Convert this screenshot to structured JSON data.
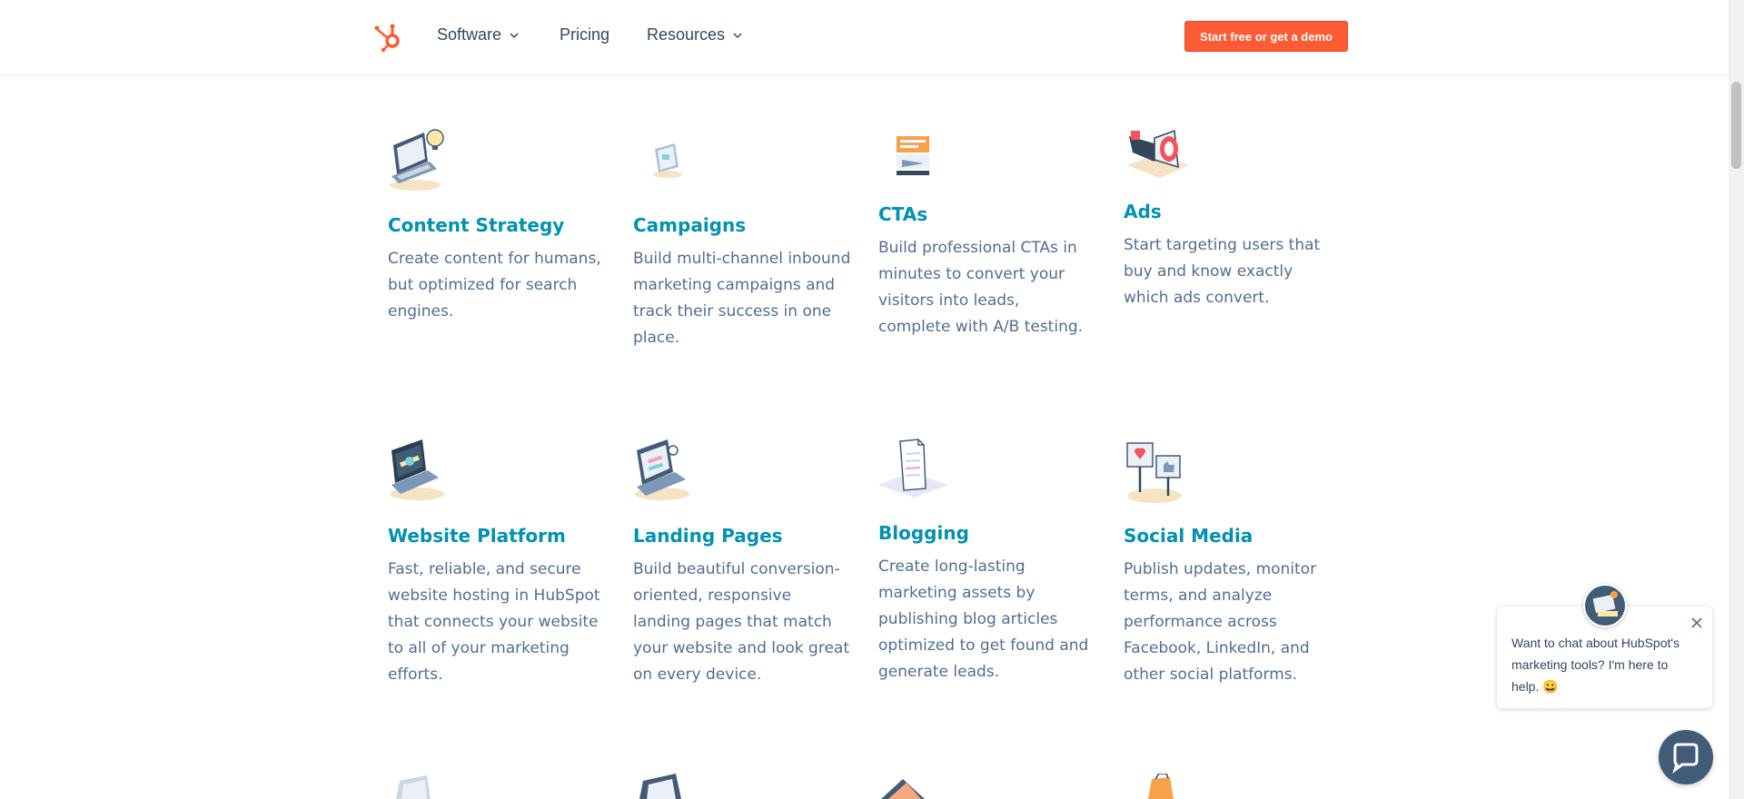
{
  "header": {
    "nav": [
      {
        "label": "Software",
        "has_dropdown": true
      },
      {
        "label": "Pricing",
        "has_dropdown": false
      },
      {
        "label": "Resources",
        "has_dropdown": true
      }
    ],
    "cta_label": "Start free or get a demo",
    "brand_color": "#ff5c35"
  },
  "features": [
    {
      "title": "Content Strategy",
      "desc": "Create content for humans, but optimized for search engines.",
      "icon": "laptop-lightbulb-icon"
    },
    {
      "title": "Campaigns",
      "desc": "Build multi-channel inbound marketing campaigns and track their success in one place.",
      "icon": "campaign-screen-icon"
    },
    {
      "title": "CTAs",
      "desc": "Build professional CTAs in minutes to convert your visitors into leads, complete with A/B testing.",
      "icon": "cta-sign-icon"
    },
    {
      "title": "Ads",
      "desc": "Start targeting users that buy and know exactly which ads convert.",
      "icon": "megaphone-icon"
    },
    {
      "title": "Website Platform",
      "desc": "Fast, reliable, and secure website hosting in HubSpot that connects your website to all of your marketing efforts.",
      "icon": "laptop-tools-icon"
    },
    {
      "title": "Landing Pages",
      "desc": "Build beautiful conversion-oriented, responsive landing pages that match your website and look great on every device.",
      "icon": "landing-page-laptop-icon"
    },
    {
      "title": "Blogging",
      "desc": "Create long-lasting marketing assets by publishing blog articles optimized to get found and generate leads.",
      "icon": "document-icon"
    },
    {
      "title": "Social Media",
      "desc": "Publish updates, monitor terms, and analyze performance across Facebook, LinkedIn, and other social platforms.",
      "icon": "social-signs-icon"
    }
  ],
  "accent_color": "#0091ae",
  "chat": {
    "message": "Want to chat about HubSpot's marketing tools? I'm here to help. 😀",
    "launcher_color": "#425b76"
  }
}
